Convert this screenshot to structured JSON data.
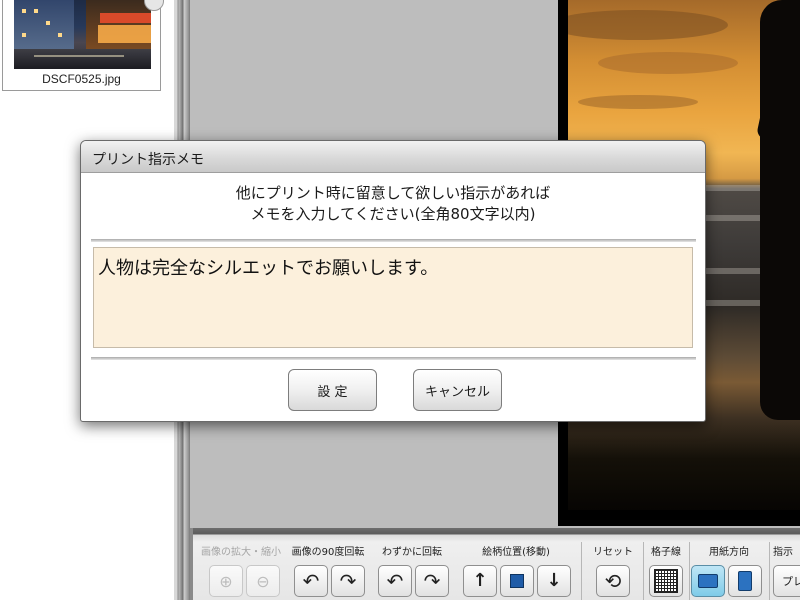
{
  "thumbnail": {
    "filename": "DSCF0525.jpg"
  },
  "dialog": {
    "title": "プリント指示メモ",
    "message_line1": "他にプリント時に留意して欲しい指示があれば",
    "message_line2": "メモを入力してください(全角80文字以内)",
    "memo_value": "人物は完全なシルエットでお願いします。",
    "ok_label": "設 定",
    "cancel_label": "キャンセル"
  },
  "toolbar": {
    "zoom_group": {
      "title": "画像の拡大・縮小",
      "enabled": false,
      "zoom_in_icon": "zoom-in-icon",
      "zoom_out_icon": "zoom-out-icon"
    },
    "rotate90_group": {
      "title": "画像の90度回転"
    },
    "fine_rotate_group": {
      "title": "わずかに回転"
    },
    "position_group": {
      "title": "絵柄位置(移動)"
    },
    "reset_group": {
      "title": "リセット"
    },
    "grid_group": {
      "title": "格子線"
    },
    "paper_group": {
      "title": "用紙方向",
      "selected": "landscape"
    },
    "next_group": {
      "title": "指示",
      "button_label": "プレ"
    }
  },
  "colors": {
    "memo_background": "#fcf0dc",
    "selected_button": "#7fcbe8",
    "position_square": "#1f5ca8"
  }
}
